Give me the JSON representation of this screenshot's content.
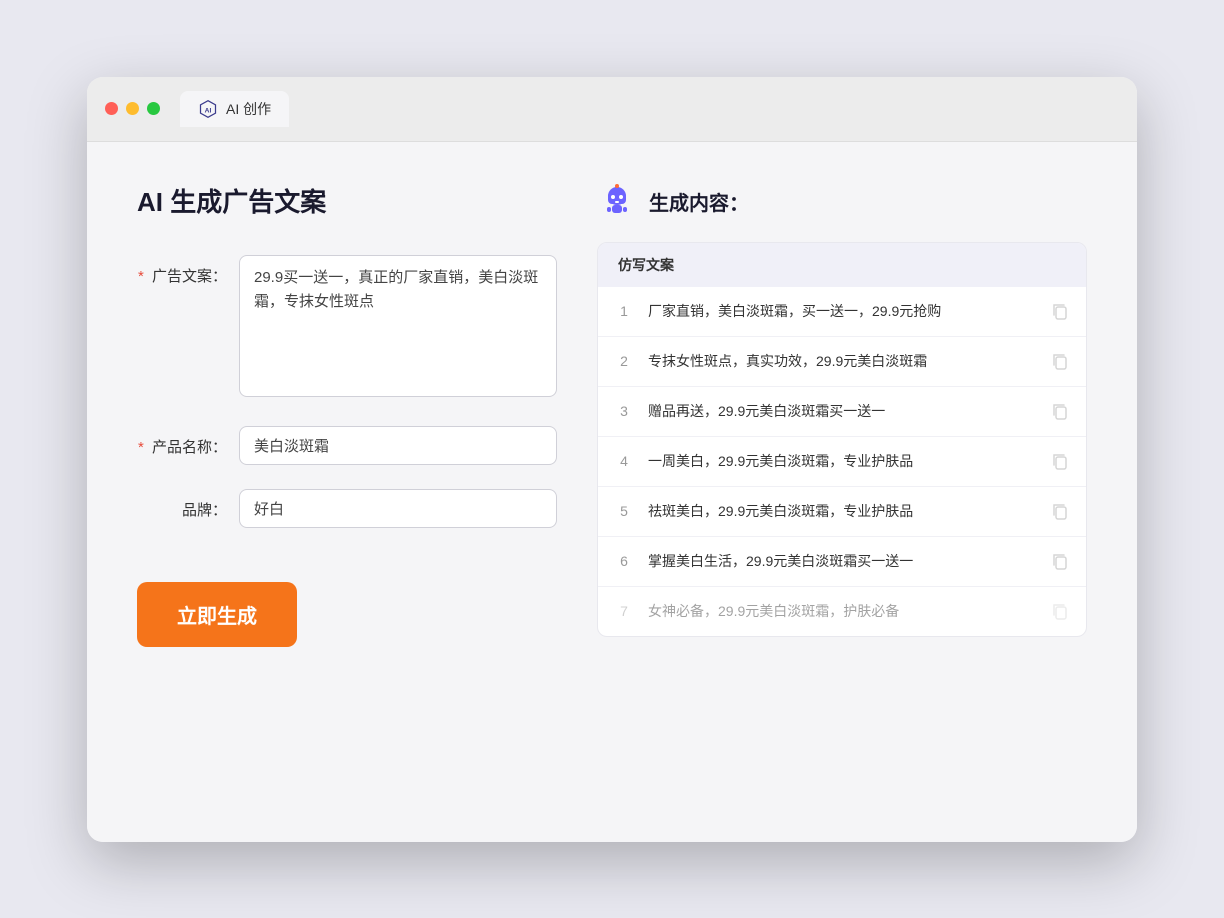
{
  "window": {
    "tab_label": "AI 创作"
  },
  "left_panel": {
    "title": "AI 生成广告文案",
    "form": {
      "ad_copy_label": "广告文案：",
      "ad_copy_value": "29.9买一送一，真正的厂家直销，美白淡斑霜，专抹女性斑点",
      "product_name_label": "产品名称：",
      "product_name_value": "美白淡斑霜",
      "brand_label": "品牌：",
      "brand_value": "好白"
    },
    "generate_button": "立即生成"
  },
  "right_panel": {
    "title": "生成内容：",
    "table_header": "仿写文案",
    "results": [
      {
        "num": 1,
        "text": "厂家直销，美白淡斑霜，买一送一，29.9元抢购",
        "dimmed": false
      },
      {
        "num": 2,
        "text": "专抹女性斑点，真实功效，29.9元美白淡斑霜",
        "dimmed": false
      },
      {
        "num": 3,
        "text": "赠品再送，29.9元美白淡斑霜买一送一",
        "dimmed": false
      },
      {
        "num": 4,
        "text": "一周美白，29.9元美白淡斑霜，专业护肤品",
        "dimmed": false
      },
      {
        "num": 5,
        "text": "祛斑美白，29.9元美白淡斑霜，专业护肤品",
        "dimmed": false
      },
      {
        "num": 6,
        "text": "掌握美白生活，29.9元美白淡斑霜买一送一",
        "dimmed": false
      },
      {
        "num": 7,
        "text": "女神必备，29.9元美白淡斑霜，护肤必备",
        "dimmed": true
      }
    ]
  },
  "colors": {
    "accent": "#f5741a",
    "required": "#e74c3c"
  }
}
